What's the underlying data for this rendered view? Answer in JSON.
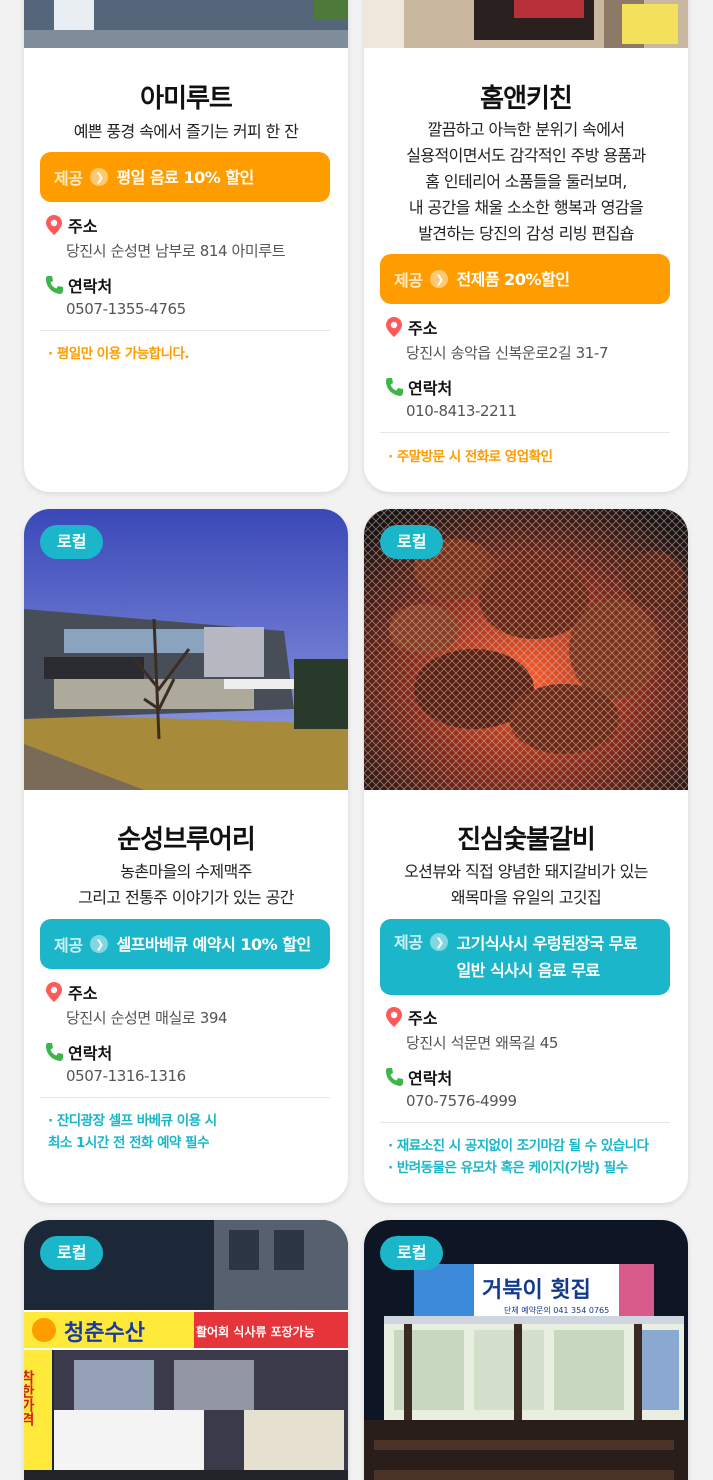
{
  "labels": {
    "offer_prefix": "제공",
    "address_heading": "주소",
    "contact_heading": "연락처",
    "badge": "로컬"
  },
  "colors": {
    "orange": "#ff9d00",
    "teal": "#1bb6c9"
  },
  "cards": [
    {
      "name": "아미루트",
      "description": [
        "예쁜 풍경 속에서 즐기는 커피 한 잔"
      ],
      "offer": [
        "평일 음료 10% 할인"
      ],
      "address": "당진시 순성면 남부로 814 아미루트",
      "phone": "0507-1355-4765",
      "notes": [
        "· 평일만 이용 가능합니다."
      ]
    },
    {
      "name": "홈앤키친",
      "description": [
        "깔끔하고 아늑한 분위기 속에서",
        "실용적이면서도 감각적인 주방 용품과",
        "홈 인테리어 소품들을 둘러보며,",
        "내 공간을 채울 소소한 행복과 영감을",
        "발견하는 당진의 감성 리빙 편집숍"
      ],
      "offer": [
        "전제품 20%할인"
      ],
      "address": "당진시 송악읍 신복운로2길 31-7",
      "phone": "010-8413-2211",
      "notes": [
        "· 주말방문 시 전화로 영업확인"
      ]
    },
    {
      "name": "순성브루어리",
      "badge": "로컬",
      "description": [
        "농촌마을의 수제맥주",
        "그리고 전통주 이야기가 있는 공간"
      ],
      "offer": [
        "셀프바베큐 예약시 10% 할인"
      ],
      "address": "당진시 순성면 매실로 394",
      "phone": "0507-1316-1316",
      "notes": [
        "· 잔디광장 셀프 바베큐 이용 시",
        "  최소 1시간 전 전화 예약 필수"
      ]
    },
    {
      "name": "진심숯불갈비",
      "badge": "로컬",
      "description": [
        "오션뷰와 직접 양념한 돼지갈비가 있는",
        "왜목마을 유일의 고깃집"
      ],
      "offer": [
        "고기식사시 우렁된장국 무료",
        "일반 식사시 음료 무료"
      ],
      "address": "당진시 석문면 왜목길 45",
      "phone": "070-7576-4999",
      "notes": [
        "· 재료소진 시 공지없이 조기마감 될 수 있습니다",
        "· 반려동물은 유모차 혹은 케이지(가방) 필수"
      ]
    },
    {
      "name": "청춘수산",
      "badge": "로컬",
      "sign_text": "청춘수산",
      "sign_text_2": "활어회 식사류 포장가능",
      "side_text": "착한가격"
    },
    {
      "name": "거북이횟집",
      "badge": "로컬",
      "sign_text": "거북이 횟집",
      "sign_sub": "단체 예약문의 041 354 0765"
    }
  ]
}
